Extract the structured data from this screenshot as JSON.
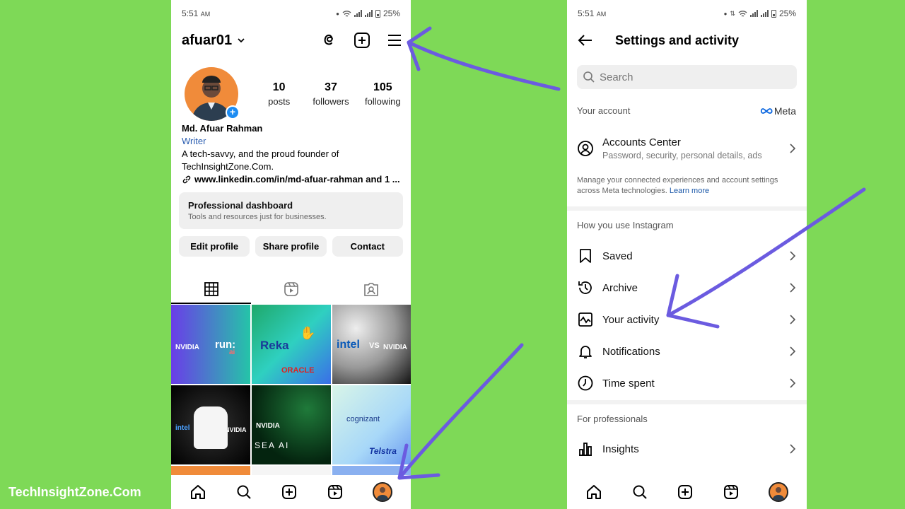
{
  "left": {
    "status": {
      "time": "5:51",
      "ampm": "AM",
      "battery": "25%"
    },
    "username": "afuar01",
    "stats": [
      {
        "num": "10",
        "label": "posts"
      },
      {
        "num": "37",
        "label": "followers"
      },
      {
        "num": "105",
        "label": "following"
      }
    ],
    "bio": {
      "name": "Md. Afuar Rahman",
      "category": "Writer",
      "line1": "A tech-savvy, and the proud founder of",
      "line2": "TechInsightZone.Com.",
      "link": "www.linkedin.com/in/md-afuar-rahman and 1 ..."
    },
    "dashboard": {
      "title": "Professional dashboard",
      "subtitle": "Tools and resources just for businesses."
    },
    "buttons": {
      "edit": "Edit profile",
      "share": "Share profile",
      "contact": "Contact"
    },
    "posts": [
      {
        "t1": "NVIDIA",
        "t2": "run:",
        "t3": "ai"
      },
      {
        "t1": "Reka",
        "t2": "ORACLE"
      },
      {
        "t1": "intel",
        "t2": "VS",
        "t3": "NVIDIA"
      },
      {
        "t1": "intel",
        "t2": "NVIDIA"
      },
      {
        "t1": "NVIDIA",
        "t2": "SEA AI"
      },
      {
        "t1": "cognizant",
        "t2": "Telstra"
      }
    ]
  },
  "right": {
    "status": {
      "time": "5:51",
      "ampm": "AM",
      "battery": "25%"
    },
    "title": "Settings and activity",
    "search_placeholder": "Search",
    "your_account": "Your account",
    "meta_label": "Meta",
    "accounts_center": {
      "title": "Accounts Center",
      "subtitle": "Password, security, personal details, ads"
    },
    "note": "Manage your connected experiences and account settings across Meta technologies.",
    "learn_more": "Learn more",
    "how_you_use": "How you use Instagram",
    "items": [
      {
        "label": "Saved",
        "icon": "bookmark-icon"
      },
      {
        "label": "Archive",
        "icon": "archive-icon"
      },
      {
        "label": "Your activity",
        "icon": "activity-icon"
      },
      {
        "label": "Notifications",
        "icon": "bell-icon"
      },
      {
        "label": "Time spent",
        "icon": "clock-icon"
      }
    ],
    "for_professionals": "For professionals",
    "insights": "Insights"
  },
  "watermark": "TechInsightZone.Com",
  "colors": {
    "background": "#7ed957",
    "arrow": "#6b5be0",
    "link": "#2a5db0",
    "verified_blue": "#1d8cf2"
  }
}
